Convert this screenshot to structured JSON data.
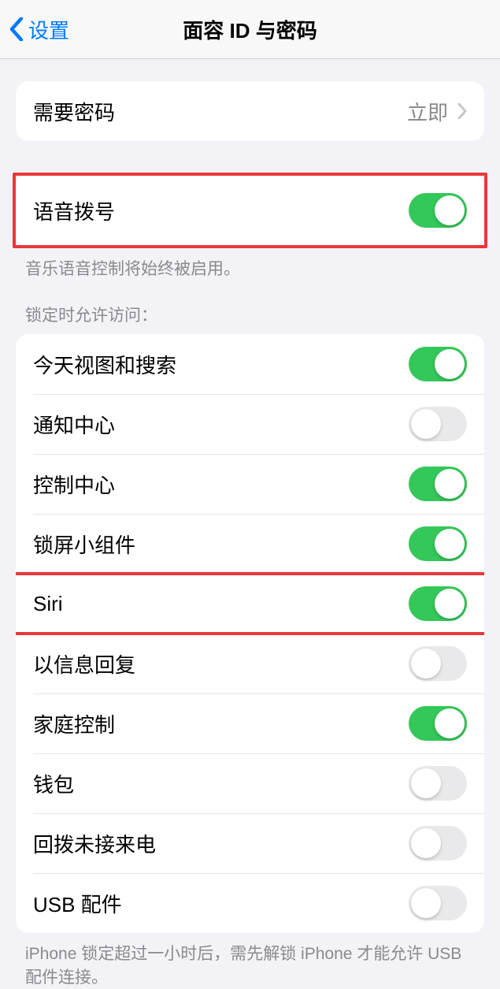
{
  "header": {
    "back_label": "设置",
    "title": "面容 ID 与密码"
  },
  "require_passcode": {
    "label": "需要密码",
    "value": "立即"
  },
  "voice_dial": {
    "label": "语音拨号",
    "enabled": true,
    "footer": "音乐语音控制将始终被启用。"
  },
  "allow_access": {
    "header": "锁定时允许访问：",
    "items": [
      {
        "label": "今天视图和搜索",
        "enabled": true,
        "highlighted": false
      },
      {
        "label": "通知中心",
        "enabled": false,
        "highlighted": false
      },
      {
        "label": "控制中心",
        "enabled": true,
        "highlighted": false
      },
      {
        "label": "锁屏小组件",
        "enabled": true,
        "highlighted": false
      },
      {
        "label": "Siri",
        "enabled": true,
        "highlighted": true
      },
      {
        "label": "以信息回复",
        "enabled": false,
        "highlighted": false
      },
      {
        "label": "家庭控制",
        "enabled": true,
        "highlighted": false
      },
      {
        "label": "钱包",
        "enabled": false,
        "highlighted": false
      },
      {
        "label": "回拨未接来电",
        "enabled": false,
        "highlighted": false
      },
      {
        "label": "USB 配件",
        "enabled": false,
        "highlighted": false
      }
    ],
    "footer": "iPhone 锁定超过一小时后，需先解锁 iPhone 才能允许 USB 配件连接。"
  }
}
